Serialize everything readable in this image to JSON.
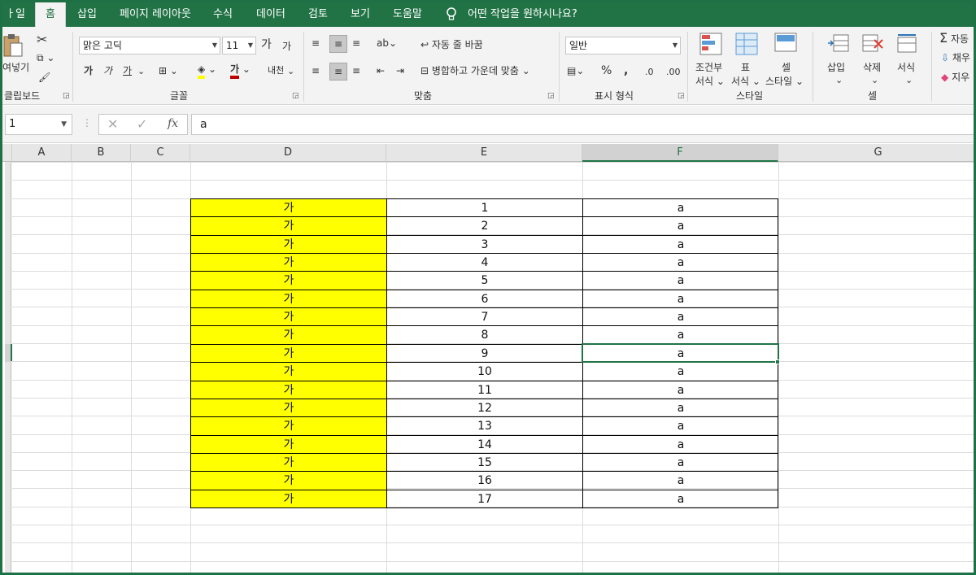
{
  "tabs": [
    "ㅏ일",
    "홈",
    "삽입",
    "페이지 레이아웃",
    "수식",
    "데이터",
    "검토",
    "보기",
    "도움말"
  ],
  "tell_me": "어떤 작업을 원하시나요?",
  "clipboard": {
    "paste": "여넣기",
    "label": "클립보드"
  },
  "font": {
    "name": "맑은 고딕",
    "size": "11",
    "grow": "가",
    "shrink": "가",
    "bold": "가",
    "italic": "가",
    "underline": "가",
    "color_letter": "가",
    "phonetic": "내천",
    "label": "글꼴"
  },
  "alignment": {
    "wrap": "자동 줄 바꿈",
    "merge": "병합하고 가운데 맞춤",
    "label": "맞춤"
  },
  "number": {
    "format": "일반",
    "percent": "%",
    "comma": ",",
    "label": "표시 형식"
  },
  "styles": {
    "conditional_1": "조건부",
    "conditional_2": "서식",
    "table_1": "표",
    "table_2": "서식",
    "cell_1": "셀",
    "cell_2": "스타일",
    "label": "스타일"
  },
  "cells": {
    "insert": "삽입",
    "delete": "삭제",
    "format": "서식",
    "label": "셀"
  },
  "editing": {
    "autosum": "자동",
    "fill": "채우",
    "clear": "지우"
  },
  "namebox": "1",
  "formula_value": "a",
  "columns": [
    "A",
    "B",
    "C",
    "D",
    "E",
    "F",
    "G"
  ],
  "table": {
    "d": [
      "가",
      "가",
      "가",
      "가",
      "가",
      "가",
      "가",
      "가",
      "가",
      "가",
      "가",
      "가",
      "가",
      "가",
      "가",
      "가",
      "가"
    ],
    "e": [
      "1",
      "2",
      "3",
      "4",
      "5",
      "6",
      "7",
      "8",
      "9",
      "10",
      "11",
      "12",
      "13",
      "14",
      "15",
      "16",
      "17"
    ],
    "f": [
      "a",
      "a",
      "a",
      "a",
      "a",
      "a",
      "a",
      "a",
      "a",
      "a",
      "a",
      "a",
      "a",
      "a",
      "a",
      "a",
      "a"
    ]
  },
  "colors": {
    "accent": "#217346",
    "highlight": "#ffff00",
    "font_color": "#c00000"
  }
}
